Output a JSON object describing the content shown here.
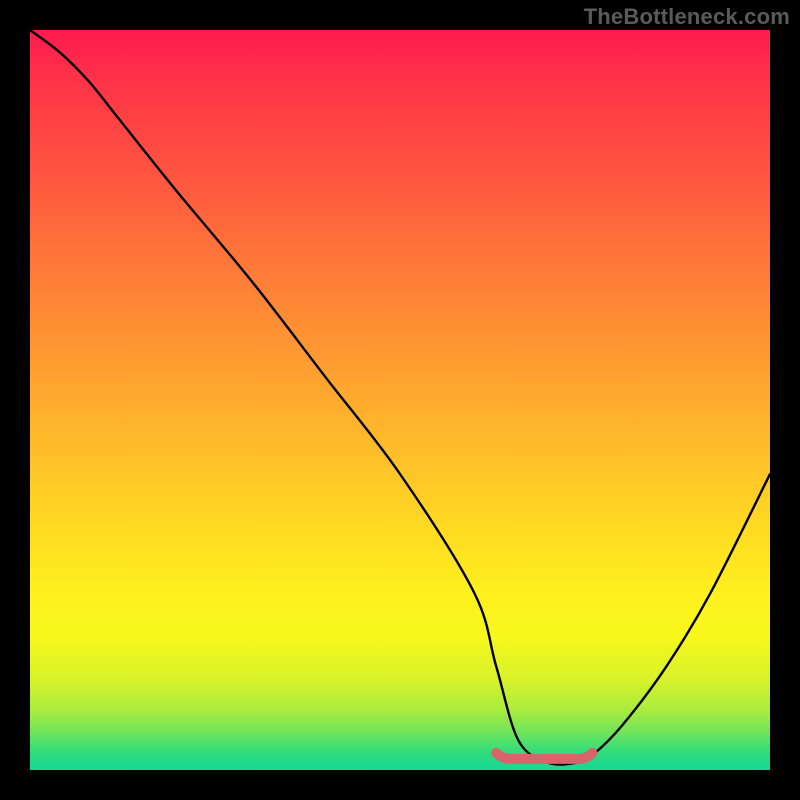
{
  "attribution": "TheBottleneck.com",
  "chart_data": {
    "type": "line",
    "title": "",
    "xlabel": "",
    "ylabel": "",
    "xlim": [
      0,
      100
    ],
    "ylim": [
      0,
      100
    ],
    "series": [
      {
        "name": "curve",
        "x": [
          0,
          4,
          8,
          12,
          20,
          30,
          40,
          50,
          60,
          63,
          66,
          70,
          74,
          76,
          80,
          86,
          92,
          100
        ],
        "values": [
          100,
          97,
          93,
          88,
          78,
          66,
          53,
          40,
          24,
          14,
          4,
          1,
          1,
          2,
          6,
          14,
          24,
          40
        ]
      }
    ],
    "flat_region": {
      "x_start": 63,
      "x_end": 76,
      "y": 1.5
    },
    "gradient_stops": [
      {
        "pos": 0.0,
        "color": "#ff1a4f"
      },
      {
        "pos": 0.5,
        "color": "#ffb02c"
      },
      {
        "pos": 0.8,
        "color": "#fff01e"
      },
      {
        "pos": 1.0,
        "color": "#18d892"
      }
    ]
  }
}
